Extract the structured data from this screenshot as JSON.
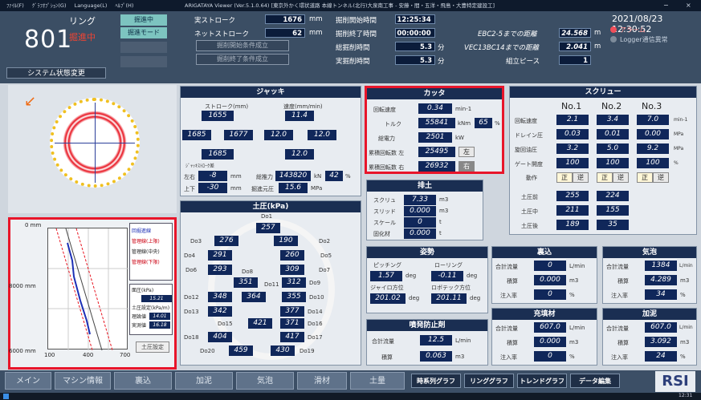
{
  "titlebar": {
    "menu": [
      "ﾌｧｲﾙ(F)",
      "ｸﾞﾗﾌｵﾌﾟｼｮﾝ(G)",
      "Language(L)",
      "ﾍﾙﾌﾟ(H)"
    ],
    "title": "ARIGATAYA Viewer (Ver.5.1.0.64) [東京外かく環状道路 本線トンネル(北行)大泉南工事 - 安藤・間・五洋・飛島・大豊特定建設工]"
  },
  "ring": {
    "label": "リング",
    "number": "801",
    "status": "掘進中",
    "mode_label": "掘進中",
    "mode2_label": "掘進モード",
    "sys_button": "システム状態変更"
  },
  "stroke": {
    "label": "実ストローク",
    "value": "1676",
    "unit": "mm",
    "net_label": "ネットストローク",
    "net_value": "62",
    "net_unit": "mm"
  },
  "conditions": {
    "start_btn": "掘削開始条件成立",
    "end_btn": "掘削終了条件成立"
  },
  "times": {
    "start_label": "掘削開始時間",
    "start_value": "12:25:34",
    "end_label": "掘削終了時間",
    "end_value": "00:00:00",
    "total_label": "総掘削時間",
    "total_value": "5.3",
    "total_unit": "分",
    "actual_label": "実掘削時間",
    "actual_value": "5.3",
    "actual_unit": "分"
  },
  "distances": {
    "d1_label": "EBC2-5までの距離",
    "d1_value": "24.568",
    "d1_unit": "m",
    "d2_label": "VEC13BC14までの距離",
    "d2_value": "2.041",
    "d2_unit": "m",
    "piece_label": "組立ピース",
    "piece_value": "1"
  },
  "clock": {
    "datetime": "2021/08/23 12:30:52",
    "alarm": "アラーム",
    "logger": "Logger通信異常"
  },
  "jack": {
    "title": "ジャッキ",
    "stroke_label": "ストローク(mm)",
    "speed_label": "速度(mm/min)",
    "s_top": "1655",
    "s_left": "1685",
    "s_right": "1677",
    "s_bottom": "1685",
    "v_top": "11.4",
    "v_left": "12.0",
    "v_right": "12.0",
    "v_bottom": "12.0",
    "diff_label": "ｼﾞｬｯｷｽﾄﾛｰｸ差",
    "lr_label": "左右",
    "lr_value": "-8",
    "lr_unit": "mm",
    "ud_label": "上下",
    "ud_value": "-30",
    "ud_unit": "mm",
    "thrust_label": "総推力",
    "thrust_value": "143820",
    "thrust_unit": "kN",
    "thrust_pct": "42",
    "pct": "%",
    "exc_label": "掘進元圧",
    "exc_value": "15.6",
    "exc_unit": "MPa"
  },
  "cutter": {
    "title": "カッタ",
    "speed_label": "回転速度",
    "speed_value": "0.34",
    "speed_unit": "min-1",
    "torque_label": "トルク",
    "torque_value": "55841",
    "torque_unit": "kNm",
    "torque_pct": "65",
    "torque_pct_unit": "%",
    "power_label": "総電力",
    "power_value": "2501",
    "power_unit": "kW",
    "rotL_label": "累積回転数 左",
    "rotL_value": "25495",
    "rotL_dir": "左",
    "rotR_label": "累積回転数 右",
    "rotR_value": "26932",
    "rotR_dir": "右"
  },
  "earth": {
    "title": "排土",
    "s1_label": "スクリュ",
    "s1_value": "7.33",
    "s1_unit": "m3",
    "s2_label": "スリッド",
    "s2_value": "0.000",
    "s2_unit": "m3",
    "s3_label": "スケール",
    "s3_value": "0",
    "s3_unit": "t",
    "s4_label": "固化材",
    "s4_value": "0.000",
    "s4_unit": "t"
  },
  "posture": {
    "title": "姿勢",
    "pitch_label": "ピッチング",
    "pitch_value": "1.57",
    "pitch_unit": "deg",
    "roll_label": "ローリング",
    "roll_value": "-0.11",
    "roll_unit": "deg",
    "gyro_label": "ジャイロ方位",
    "gyro_value": "201.02",
    "gyro_unit": "deg",
    "robo_label": "ロボテック方位",
    "robo_value": "201.11",
    "robo_unit": "deg"
  },
  "spray": {
    "title": "噴発防止剤",
    "flow_label": "合計流量",
    "flow_value": "12.5",
    "flow_unit": "L/min",
    "acc_label": "積算",
    "acc_value": "0.063",
    "acc_unit": "m3"
  },
  "screw": {
    "title": "スクリュー",
    "cols": [
      "No.1",
      "No.2",
      "No.3"
    ],
    "rows": [
      {
        "label": "回転速度",
        "v": [
          "2.1",
          "3.4",
          "7.0"
        ],
        "unit": "min-1"
      },
      {
        "label": "ドレイン圧",
        "v": [
          "0.03",
          "0.01",
          "0.00"
        ],
        "unit": "MPa"
      },
      {
        "label": "旋回油圧",
        "v": [
          "3.2",
          "5.0",
          "9.2"
        ],
        "unit": "MPa"
      },
      {
        "label": "ゲート開度",
        "v": [
          "100",
          "100",
          "100"
        ],
        "unit": "%"
      }
    ],
    "dir_label": "動作",
    "dir": [
      "正",
      "逆"
    ],
    "p_rows": [
      {
        "label": "土圧前",
        "v": [
          "255",
          "224"
        ]
      },
      {
        "label": "土圧中",
        "v": [
          "211",
          "155"
        ]
      },
      {
        "label": "土圧後",
        "v": [
          "189",
          "35"
        ]
      }
    ]
  },
  "earth_pressure": {
    "title": "土圧(kPa)",
    "labels": {
      "do1": "Do1",
      "do2": "Do2",
      "do3": "Do3",
      "do4": "Do4",
      "do5": "Do5",
      "do6": "Do6",
      "do7": "Do7",
      "do8": "Do8",
      "do9": "Do9",
      "do10": "Do10",
      "do11": "Do11",
      "do12": "Do12",
      "do13": "Do13",
      "do14": "Do14",
      "do15": "Do15",
      "do16": "Do16",
      "do17": "Do17",
      "do18": "Do18",
      "do19": "Do19",
      "do20": "Do20"
    },
    "values": {
      "v1": "257",
      "v2": "190",
      "v3": "276",
      "v4": "291",
      "v5": "260",
      "v6": "293",
      "v7": "309",
      "v8": "351",
      "v9": "312",
      "v10": "355",
      "v11": "348",
      "v12": "364",
      "v13": "342",
      "v14": "377",
      "v15": "421",
      "v16": "371",
      "v17": "404",
      "v18": "417",
      "v19": "459",
      "v20": "430"
    }
  },
  "backfill": {
    "title": "裏込",
    "flow_label": "合計流量",
    "flow_value": "0",
    "flow_unit": "L/min",
    "acc_label": "積算",
    "acc_value": "0.000",
    "acc_unit": "m3",
    "rate_label": "注入率",
    "rate_value": "0",
    "rate_unit": "%"
  },
  "foam": {
    "title": "気泡",
    "flow_label": "合計流量",
    "flow_value": "1384",
    "flow_unit": "L/min",
    "acc_label": "積算",
    "acc_value": "4.289",
    "acc_unit": "m3",
    "rate_label": "注入率",
    "rate_value": "34",
    "rate_unit": "%"
  },
  "filler": {
    "title": "充填材",
    "flow_label": "合計流量",
    "flow_value": "607.0",
    "flow_unit": "L/min",
    "acc_label": "積算",
    "acc_value": "0.000",
    "acc_unit": "m3",
    "rate_label": "注入率",
    "rate_value": "0",
    "rate_unit": "%"
  },
  "mud": {
    "title": "加泥",
    "flow_label": "合計流量",
    "flow_value": "607.0",
    "flow_unit": "L/min",
    "acc_label": "積算",
    "acc_value": "3.092",
    "acc_unit": "m3",
    "rate_label": "注入率",
    "rate_value": "24",
    "rate_unit": "%"
  },
  "graph": {
    "y_top": "0 mm",
    "y_mid": "8000 mm",
    "y_bot": "6000 mm",
    "x_ticks": [
      "100",
      "400",
      "700"
    ],
    "legend": [
      "回掘進線",
      "管理線(上限)",
      "管理線(中央)",
      "管理線(下限)"
    ],
    "p_label": "面圧(kPa)",
    "p_value": "15.21",
    "vals_label": "土圧設定(kPa/m)",
    "v1": "14.01",
    "v2": "16.18",
    "mgmt_label": "理論値",
    "actual_label": "実測値",
    "button": "土圧設定"
  },
  "bottom": {
    "tabs": [
      "メイン",
      "マシン情報",
      "裏込",
      "加泥",
      "気泡",
      "滑材",
      "土量"
    ],
    "tabs2": [
      "時系列グラフ",
      "リンググラフ",
      "トレンドグラフ",
      "データ編集"
    ],
    "logo": "RSI"
  },
  "taskbar": {
    "time": "12:31"
  }
}
